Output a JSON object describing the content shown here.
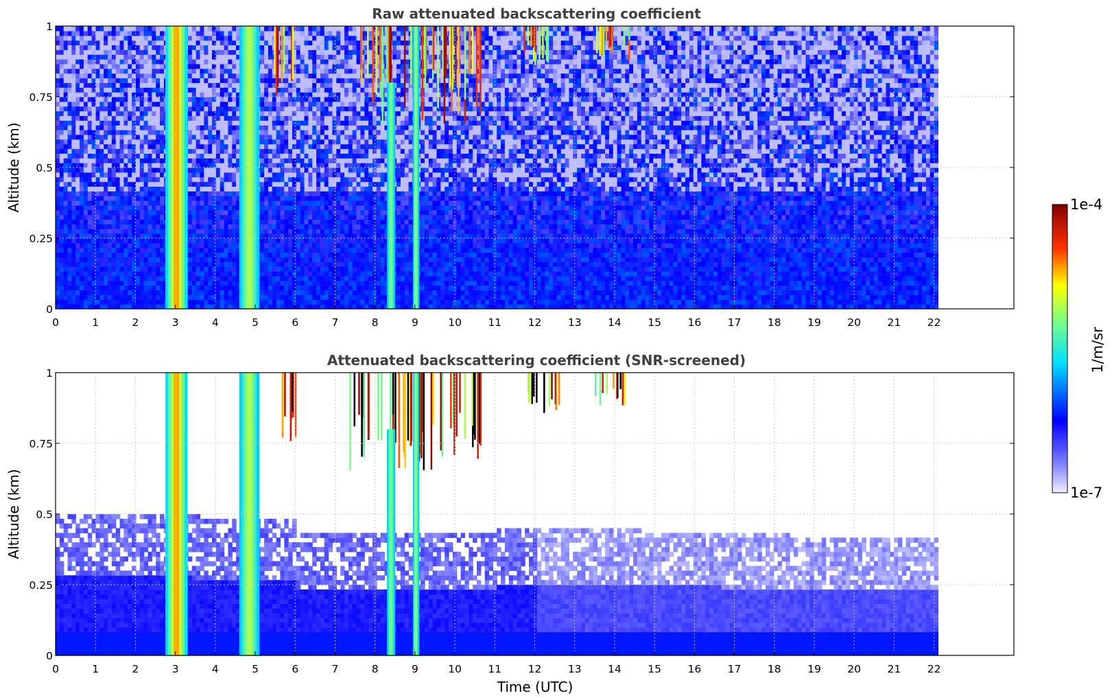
{
  "chart_data": [
    {
      "type": "heatmap",
      "title": "Raw attenuated backscattering coefficient",
      "xlabel": "",
      "ylabel": "Altitude (km)",
      "xlim": [
        0,
        24
      ],
      "ylim": [
        0,
        1
      ],
      "x_ticks": [
        0,
        1,
        2,
        3,
        4,
        5,
        6,
        7,
        8,
        9,
        10,
        11,
        12,
        13,
        14,
        15,
        16,
        17,
        18,
        19,
        20,
        21,
        22
      ],
      "y_ticks": [
        0,
        0.25,
        0.5,
        0.75,
        1
      ],
      "y_tick_labels": [
        "0",
        "0.25",
        "0.5",
        "0.75",
        "1"
      ],
      "data_time_range": [
        0,
        22.1
      ],
      "grid": true,
      "screened": false,
      "cloud_columns": [
        {
          "t0": 2.75,
          "t1": 3.3,
          "intensity": 0.85,
          "h1": 1.0
        },
        {
          "t0": 4.6,
          "t1": 5.1,
          "intensity": 0.55,
          "h1": 1.0
        },
        {
          "t0": 8.3,
          "t1": 8.5,
          "intensity": 0.45,
          "h1": 0.8
        },
        {
          "t0": 8.95,
          "t1": 9.1,
          "intensity": 0.5,
          "h1": 1.0
        }
      ],
      "high_cloud_regions": [
        {
          "t0": 5.4,
          "t1": 6.0,
          "h0": 0.75,
          "h1": 1.0
        },
        {
          "t0": 7.3,
          "t1": 10.7,
          "h0": 0.65,
          "h1": 1.0
        },
        {
          "t0": 11.7,
          "t1": 12.6,
          "h0": 0.85,
          "h1": 1.0
        },
        {
          "t0": 13.5,
          "t1": 14.4,
          "h0": 0.88,
          "h1": 1.0
        }
      ]
    },
    {
      "type": "heatmap",
      "title": "Attenuated backscattering coefficient (SNR-screened)",
      "xlabel": "Time (UTC)",
      "ylabel": "Altitude (km)",
      "xlim": [
        0,
        24
      ],
      "ylim": [
        0,
        1
      ],
      "x_ticks": [
        0,
        1,
        2,
        3,
        4,
        5,
        6,
        7,
        8,
        9,
        10,
        11,
        12,
        13,
        14,
        15,
        16,
        17,
        18,
        19,
        20,
        21,
        22
      ],
      "y_ticks": [
        0,
        0.25,
        0.5,
        0.75,
        1
      ],
      "y_tick_labels": [
        "0",
        "0.25",
        "0.5",
        "0.75",
        "1"
      ],
      "data_time_range": [
        0,
        22.1
      ],
      "grid": true,
      "screened": true,
      "cloud_columns": [
        {
          "t0": 2.75,
          "t1": 3.3,
          "intensity": 0.85,
          "h1": 1.0
        },
        {
          "t0": 4.6,
          "t1": 5.1,
          "intensity": 0.55,
          "h1": 1.0
        },
        {
          "t0": 8.3,
          "t1": 8.5,
          "intensity": 0.45,
          "h1": 0.8
        },
        {
          "t0": 8.95,
          "t1": 9.1,
          "intensity": 0.5,
          "h1": 1.0
        }
      ],
      "high_cloud_regions": [
        {
          "t0": 5.4,
          "t1": 6.0,
          "h0": 0.75,
          "h1": 1.0
        },
        {
          "t0": 7.3,
          "t1": 10.7,
          "h0": 0.65,
          "h1": 1.0
        },
        {
          "t0": 11.7,
          "t1": 12.6,
          "h0": 0.85,
          "h1": 1.0
        },
        {
          "t0": 13.5,
          "t1": 14.4,
          "h0": 0.88,
          "h1": 1.0
        }
      ]
    }
  ],
  "colorbar": {
    "label": "1/m/sr",
    "max_label": "1e-4",
    "min_label": "1e-7",
    "colormap": [
      "#e8e8ff",
      "#0000ff",
      "#00ffff",
      "#ffff00",
      "#ff0000",
      "#800000"
    ]
  }
}
